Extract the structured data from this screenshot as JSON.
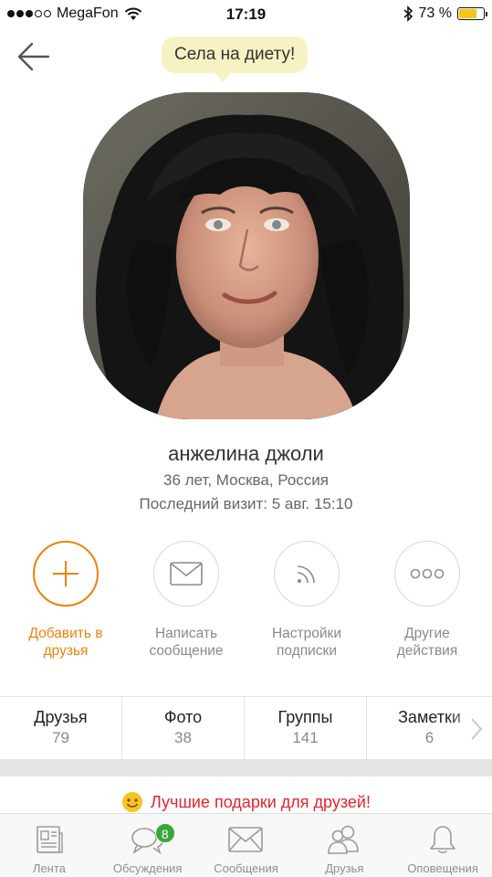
{
  "statusbar": {
    "carrier": "MegaFon",
    "time": "17:19",
    "battery_text": "73 %",
    "battery_level": 0.73,
    "signal_bars_filled": 3,
    "signal_bars_total": 5
  },
  "profile": {
    "status_bubble": "Села на диету!",
    "name": "анжелина джоли",
    "age_location": "36 лет, Москва, Россия",
    "last_visit": "Последний визит: 5 авг. 15:10"
  },
  "actions": [
    {
      "label": "Добавить в\nдрузья",
      "icon": "plus-icon",
      "primary": true
    },
    {
      "label": "Написать\nсообщение",
      "icon": "envelope-icon",
      "primary": false
    },
    {
      "label": "Настройки\nподписки",
      "icon": "feed-icon",
      "primary": false
    },
    {
      "label": "Другие\nдействия",
      "icon": "more-icon",
      "primary": false
    }
  ],
  "counters": [
    {
      "title": "Друзья",
      "value": "79"
    },
    {
      "title": "Фото",
      "value": "38"
    },
    {
      "title": "Группы",
      "value": "141"
    },
    {
      "title": "Заметки",
      "value": "6"
    }
  ],
  "gifts_banner": "Лучшие подарки для друзей!",
  "tabbar": [
    {
      "label": "Лента",
      "icon": "feed-tab-icon"
    },
    {
      "label": "Обсуждения",
      "icon": "discussions-icon",
      "badge": "8"
    },
    {
      "label": "Сообщения",
      "icon": "messages-icon"
    },
    {
      "label": "Друзья",
      "icon": "friends-icon"
    },
    {
      "label": "Оповещения",
      "icon": "bell-icon"
    }
  ],
  "colors": {
    "accent": "#ee8208",
    "badge": "#35a839",
    "gifts_text": "#e3242b",
    "bubble": "#f6f2c3"
  }
}
